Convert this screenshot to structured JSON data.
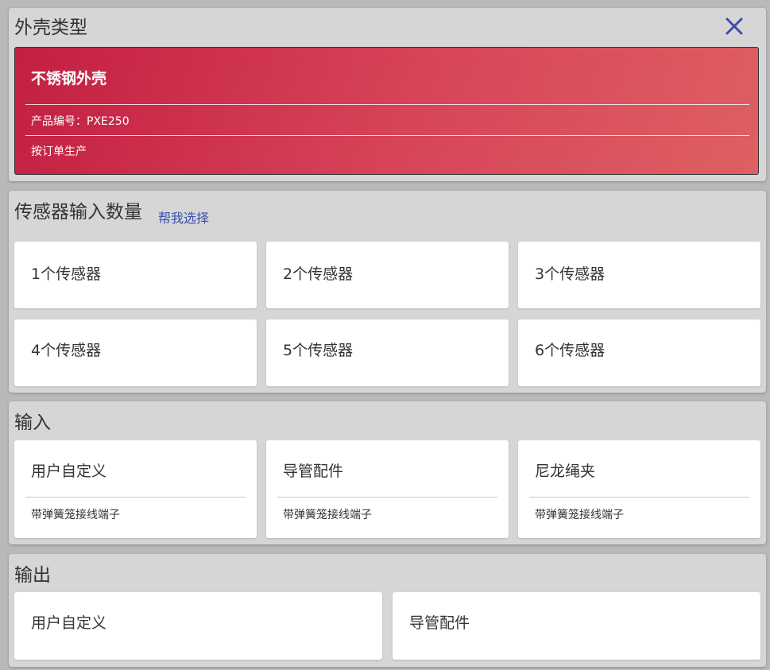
{
  "housing": {
    "title": "外壳类型",
    "close_icon": "close-icon",
    "selected": {
      "name": "不锈钢外壳",
      "product_code": "产品编号：PXE250",
      "note": "按订单生产",
      "colors": [
        "#c31f42",
        "#dd6062"
      ]
    }
  },
  "sensors": {
    "title": "传感器输入数量",
    "help_link": "帮我选择",
    "options": [
      "1个传感器",
      "2个传感器",
      "3个传感器",
      "4个传感器",
      "5个传感器",
      "6个传感器"
    ]
  },
  "input": {
    "title": "输入",
    "options": [
      {
        "label": "用户自定义",
        "sub": "带弹簧笼接线端子"
      },
      {
        "label": "导管配件",
        "sub": "带弹簧笼接线端子"
      },
      {
        "label": "尼龙绳夹",
        "sub": "带弹簧笼接线端子"
      }
    ]
  },
  "output": {
    "title": "输出",
    "options": [
      "用户自定义",
      "导管配件"
    ]
  }
}
